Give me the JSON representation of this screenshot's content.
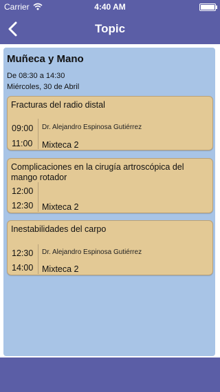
{
  "status_bar": {
    "carrier": "Carrier",
    "time": "4:40 AM"
  },
  "nav": {
    "title": "Topic",
    "back_icon": "chevron-left-icon"
  },
  "panel": {
    "title": "Muñeca y Mano",
    "time_range": "De 08:30 a 14:30",
    "date": "Miércoles, 30 de Abril"
  },
  "sessions": [
    {
      "title": "Fracturas del radio distal",
      "start": "09:00",
      "end": "11:00",
      "speaker": "Dr. Alejandro Espinosa Gutiérrez",
      "room": "Mixteca 2"
    },
    {
      "title": "Complicaciones en la cirugía artroscópica del mango rotador",
      "start": "12:00",
      "end": "12:30",
      "speaker": "",
      "room": "Mixteca 2"
    },
    {
      "title": "Inestabilidades del carpo",
      "start": "12:30",
      "end": "14:00",
      "speaker": "Dr. Alejandro Espinosa Gutiérrez",
      "room": "Mixteca 2"
    }
  ],
  "colors": {
    "bar": "#5b5ea6",
    "panel": "#a8c4e6",
    "card": "#e3c995"
  }
}
